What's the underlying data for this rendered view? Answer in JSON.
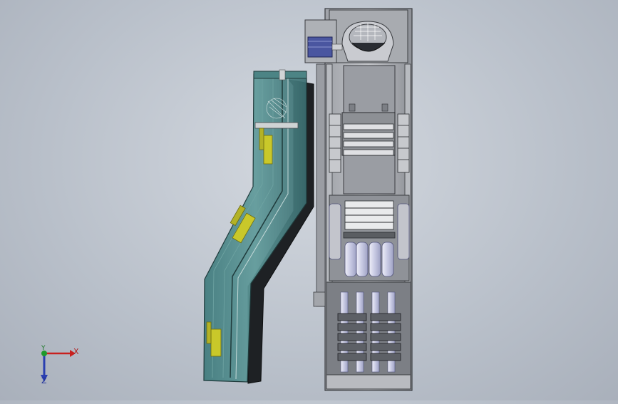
{
  "viewport": {
    "background": "#c2c8d0",
    "model": "chute-conveyor-assembly"
  },
  "triad": {
    "x_label": "X",
    "y_label": "Y",
    "z_label": "Z",
    "x_color": "#c8201e",
    "y_color": "#1e9a2c",
    "z_color": "#2a3fb0"
  },
  "colors": {
    "chute_glass": "#4f8a8c",
    "chute_dark": "#1c1f22",
    "frame_gray": "#8e9197",
    "frame_light": "#d9dadd",
    "roller_blue": "#c9cbe4",
    "highlight_yellow": "#c9c82a"
  }
}
